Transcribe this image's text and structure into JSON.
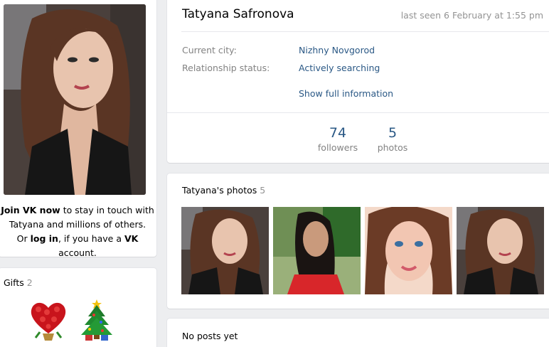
{
  "profile": {
    "name": "Tatyana Safronova",
    "last_seen": "last seen 6 February at 1:55 pm",
    "info": [
      {
        "label": "Current city:",
        "value": "Nizhny Novgorod"
      },
      {
        "label": "Relationship status:",
        "value": "Actively searching"
      }
    ],
    "show_full": "Show full information",
    "counters": [
      {
        "num": "74",
        "label": "followers"
      },
      {
        "num": "5",
        "label": "photos"
      }
    ]
  },
  "join": {
    "join_bold": "Join VK now",
    "line1_rest": " to stay in touch with",
    "line2": "Tatyana and millions of others.",
    "or": "Or ",
    "log_in": "log in",
    "if_you": ", if you have a ",
    "vk": "VK",
    "account": " account."
  },
  "gifts": {
    "title": "Gifts",
    "count": "2"
  },
  "photos": {
    "title": "Tatyana's photos",
    "count": "5"
  },
  "posts": {
    "empty": "No posts yet"
  }
}
